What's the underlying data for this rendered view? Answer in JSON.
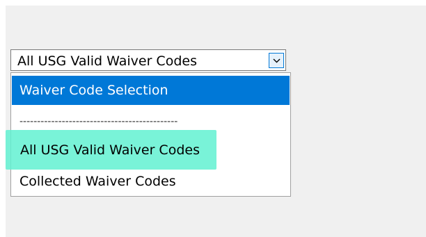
{
  "combo": {
    "value": "All USG Valid Waiver Codes",
    "button_icon": "chevron-down-icon"
  },
  "dropdown": {
    "options": [
      {
        "label": "Waiver Code Selection",
        "state": "highlighted"
      },
      {
        "label": "---------------------------------------------",
        "state": "separator"
      },
      {
        "label": "All USG Valid Waiver Codes",
        "state": "annotated"
      },
      {
        "label": "Collected Waiver Codes",
        "state": "normal"
      }
    ]
  },
  "colors": {
    "selection": "#0078d7",
    "annotation_highlight": "#62f1d1",
    "panel_background": "#f0f0f0"
  }
}
